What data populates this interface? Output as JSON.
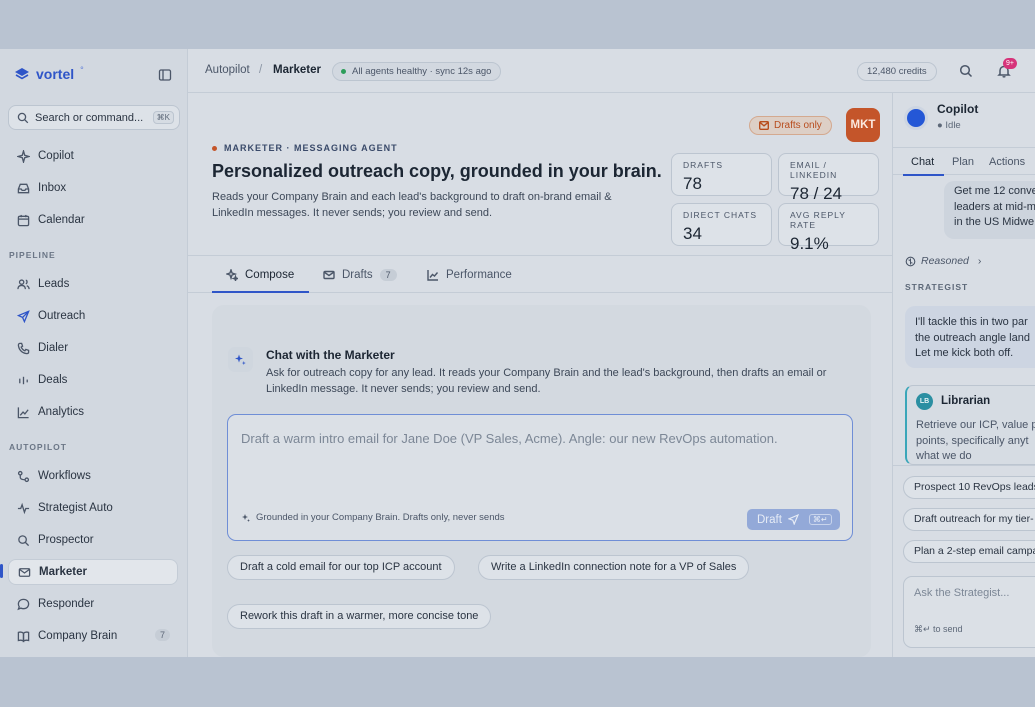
{
  "brand": {
    "name": "vortel",
    "mark": "°"
  },
  "search": {
    "label": "Search or command...",
    "shortcut": "⌘K"
  },
  "nav": {
    "top": [
      {
        "label": "Copilot",
        "icon": "sparkle-icon"
      },
      {
        "label": "Inbox",
        "icon": "inbox-icon"
      },
      {
        "label": "Calendar",
        "icon": "calendar-icon"
      }
    ],
    "pipeline_label": "PIPELINE",
    "pipeline": [
      {
        "label": "Leads",
        "icon": "users-icon"
      },
      {
        "label": "Outreach",
        "icon": "send-icon"
      },
      {
        "label": "Dialer",
        "icon": "phone-icon"
      },
      {
        "label": "Deals",
        "icon": "deals-icon"
      },
      {
        "label": "Analytics",
        "icon": "chart-icon"
      }
    ],
    "autopilot_label": "AUTOPILOT",
    "autopilot": [
      {
        "label": "Workflows",
        "icon": "workflow-icon"
      },
      {
        "label": "Strategist Auto",
        "icon": "pulse-icon"
      },
      {
        "label": "Prospector",
        "icon": "search-icon"
      },
      {
        "label": "Marketer",
        "icon": "mail-icon"
      },
      {
        "label": "Responder",
        "icon": "chat-bubble-icon"
      },
      {
        "label": "Company Brain",
        "icon": "book-icon",
        "badge": "7"
      }
    ]
  },
  "topbar": {
    "crumb_parent": "Autopilot",
    "crumb_sep": "/",
    "crumb_current": "Marketer",
    "health": "All agents healthy · sync 12s ago",
    "credits": "12,480 credits",
    "notif_count": "9+"
  },
  "header": {
    "drafts_only": "Drafts only",
    "avatar": "MKT",
    "kicker": "MARKETER · MESSAGING AGENT",
    "title": "Personalized outreach copy, grounded in your brain.",
    "subtitle": "Reads your Company Brain and each lead's background to draft on-brand email & LinkedIn messages. It never sends; you review and send.",
    "stats": [
      {
        "label": "DRAFTS",
        "value": "78"
      },
      {
        "label": "EMAIL / LINKEDIN",
        "value": "78 / 24"
      },
      {
        "label": "DIRECT CHATS",
        "value": "34"
      },
      {
        "label": "AVG REPLY RATE",
        "value": "9.1%"
      }
    ]
  },
  "tabs": [
    {
      "label": "Compose"
    },
    {
      "label": "Drafts",
      "count": "7"
    },
    {
      "label": "Performance"
    }
  ],
  "chat": {
    "title": "Chat with the Marketer",
    "description": "Ask for outreach copy for any lead. It reads your Company Brain and the lead's background, then drafts an email or LinkedIn message. It never sends; you review and send.",
    "placeholder": "Draft a warm intro email for Jane Doe (VP Sales, Acme). Angle: our new RevOps automation.",
    "grounded": "Grounded in your Company Brain. Drafts only, never sends",
    "draft_button": "Draft",
    "draft_shortcut": "⌘↵",
    "suggestions": [
      "Draft a cold email for our top ICP account",
      "Write a LinkedIn connection note for a VP of Sales",
      "Rework this draft in a warmer, more concise tone"
    ]
  },
  "copilot": {
    "name": "Copilot",
    "status": "Idle",
    "tabs": [
      "Chat",
      "Plan",
      "Actions"
    ],
    "user_message": [
      "Get me 12 conve",
      "leaders at mid-m",
      "in the US Midwe"
    ],
    "reasoned": "Reasoned",
    "strategist_label": "STRATEGIST",
    "strategist_message": [
      "I'll tackle this in two par",
      "the outreach angle land",
      "Let me kick both off."
    ],
    "librarian": {
      "initials": "LB",
      "name": "Librarian",
      "text": [
        "Retrieve our ICP, value p",
        "points, specifically anyt",
        "what we do"
      ]
    },
    "suggestions": [
      "Prospect 10 RevOps leads",
      "Draft outreach for my tier-",
      "Plan a 2-step email campa"
    ],
    "ask_placeholder": "Ask the Strategist...",
    "ask_hint": "⌘↵ to send"
  }
}
